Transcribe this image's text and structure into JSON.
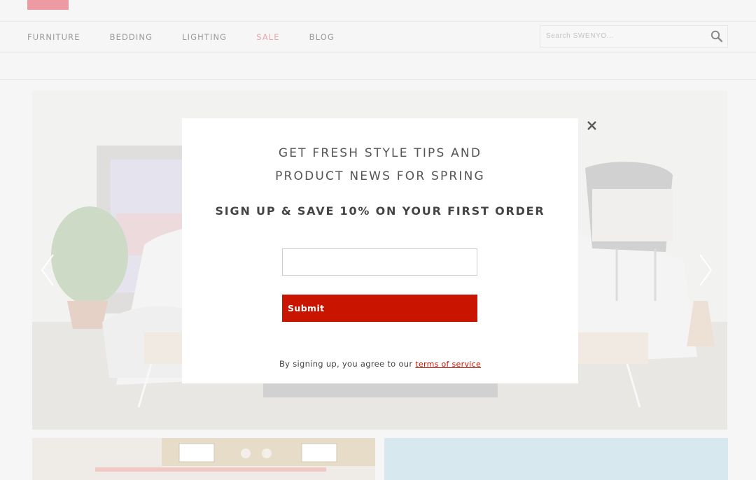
{
  "nav": {
    "items": [
      {
        "label": "FURNITURE"
      },
      {
        "label": "BEDDING"
      },
      {
        "label": "LIGHTING"
      },
      {
        "label": "SALE"
      },
      {
        "label": "BLOG"
      }
    ]
  },
  "search": {
    "placeholder": "Search SWENYO..."
  },
  "colors": {
    "logo_block": "#ee9aa3",
    "sale_link": "#e7a8a8",
    "submit_bg": "#c91400",
    "terms_link": "#c91400"
  },
  "icons": {
    "search": "search-icon",
    "close": "close-icon",
    "prev": "chevron-left-icon",
    "next": "chevron-right-icon"
  },
  "popup": {
    "headline_line1": "GET FRESH STYLE TIPS AND",
    "headline_line2": "PRODUCT NEWS FOR SPRING",
    "offer": "SIGN UP & SAVE 10% ON YOUR FIRST ORDER",
    "email_value": "",
    "submit_label": "Submit",
    "terms_prefix": "By signing up, you agree to our",
    "terms_link": "terms of service"
  }
}
